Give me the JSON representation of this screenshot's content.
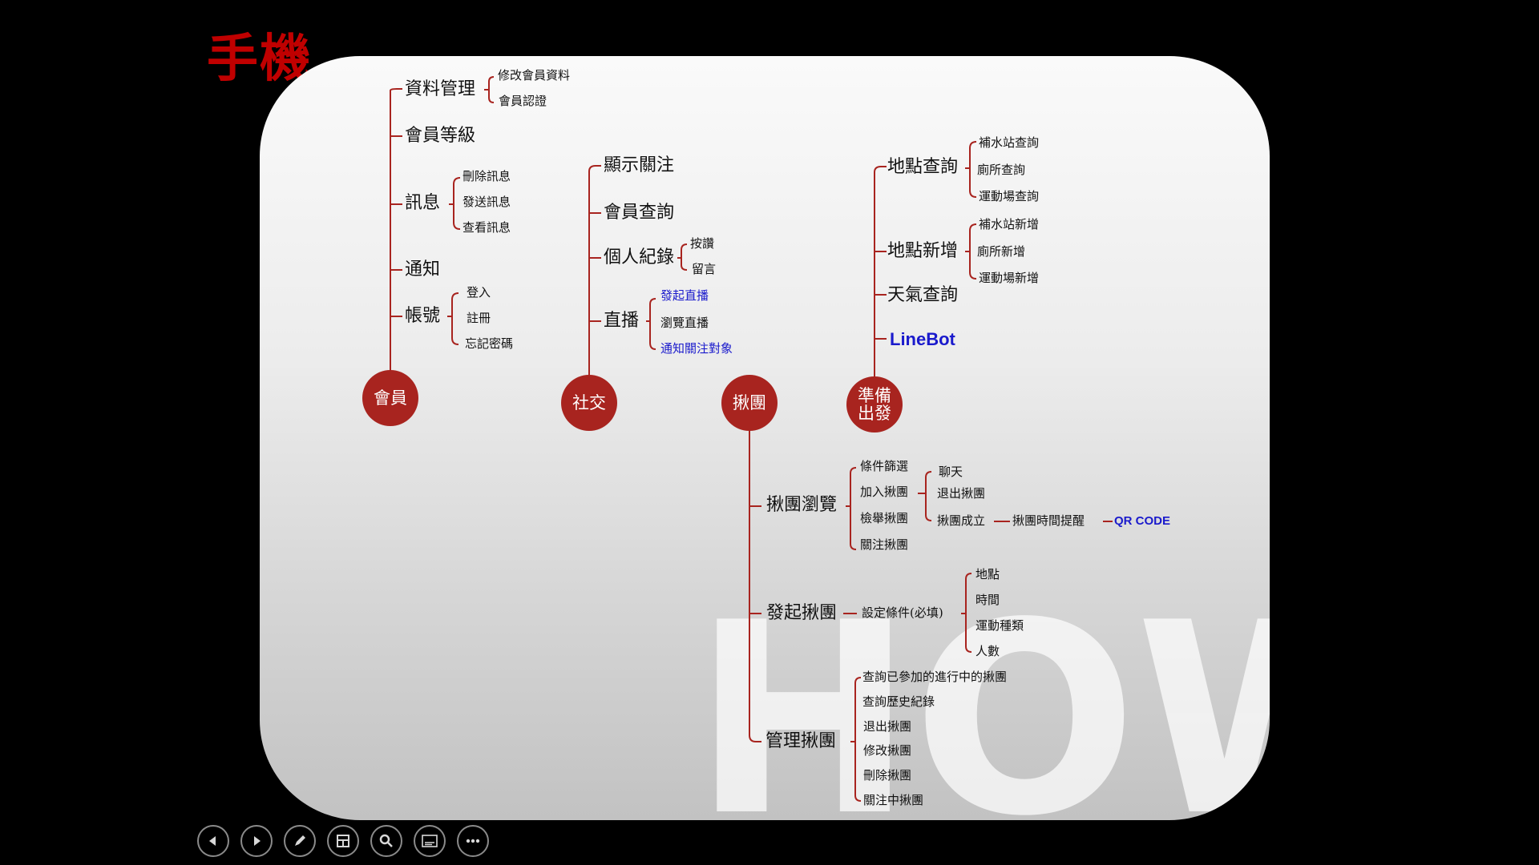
{
  "slide_title": "手機",
  "watermark": "HOW",
  "accent_color": "#a8241f",
  "title_color": "#c00000",
  "link_color": "#1a1acc",
  "hubs": {
    "member": "會員",
    "social": "社交",
    "group": "揪團",
    "prepare_line1": "準備",
    "prepare_line2": "出發"
  },
  "member": {
    "data_mgmt": "資料管理",
    "edit_member_data": "修改會員資料",
    "member_verify": "會員認證",
    "member_level": "會員等級",
    "message": "訊息",
    "delete_message": "刪除訊息",
    "send_message": "發送訊息",
    "view_message": "查看訊息",
    "notification": "通知",
    "account": "帳號",
    "login": "登入",
    "register": "註冊",
    "forgot_password": "忘記密碼"
  },
  "social": {
    "show_follow": "顯示關注",
    "member_search": "會員查詢",
    "personal_record": "個人紀錄",
    "like": "按讚",
    "comment": "留言",
    "live": "直播",
    "start_live": "發起直播",
    "browse_live": "瀏覽直播",
    "notify_followers": "通知關注對象"
  },
  "prepare": {
    "location_query": "地點查詢",
    "water_query": "補水站查詢",
    "toilet_query": "廁所查詢",
    "sports_query": "運動場查詢",
    "location_add": "地點新增",
    "water_add": "補水站新增",
    "toilet_add": "廁所新增",
    "sports_add": "運動場新增",
    "weather_query": "天氣查詢",
    "linebot": "LineBot"
  },
  "group": {
    "browse": "揪團瀏覽",
    "filter": "條件篩選",
    "join": "加入揪團",
    "report": "檢舉揪團",
    "follow": "關注揪團",
    "chat": "聊天",
    "leave": "退出揪團",
    "formed": "揪團成立",
    "time_reminder": "揪團時間提醒",
    "qr_code": "QR CODE",
    "initiate": "發起揪團",
    "set_conditions": "設定條件(必填)",
    "place": "地點",
    "time": "時間",
    "sport_type": "運動種類",
    "people": "人數",
    "manage": "管理揪團",
    "query_joined": "查詢已參加的進行中的揪團",
    "query_history": "查詢歷史紀錄",
    "m_leave": "退出揪團",
    "edit": "修改揪團",
    "delete": "刪除揪團",
    "following": "關注中揪團"
  },
  "toolbar": [
    "prev-icon",
    "next-icon",
    "pen-icon",
    "slides-icon",
    "zoom-icon",
    "subtitle-icon",
    "more-icon"
  ]
}
